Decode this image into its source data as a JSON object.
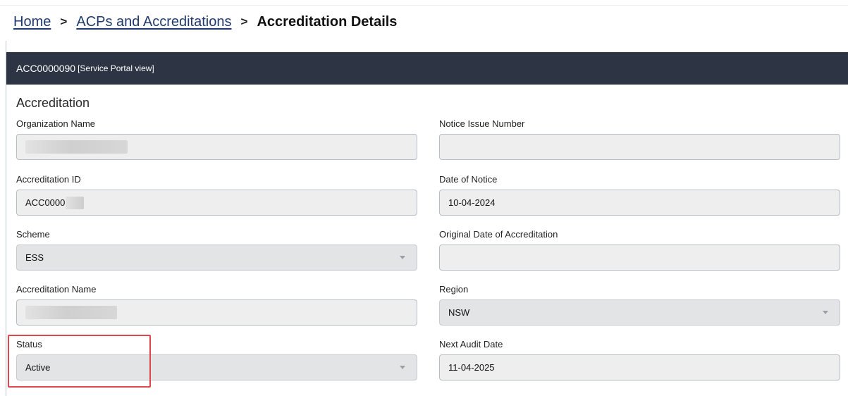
{
  "breadcrumb": {
    "home": "Home",
    "acps": "ACPs and Accreditations",
    "current": "Accreditation Details",
    "separator": ">"
  },
  "panel": {
    "record_id": "ACC0000090",
    "view_tag": "[Service Portal view]"
  },
  "section_title": "Accreditation",
  "fields": {
    "organization_name": {
      "label": "Organization Name",
      "value": ""
    },
    "notice_issue_number": {
      "label": "Notice Issue Number",
      "value": ""
    },
    "accreditation_id": {
      "label": "Accreditation ID",
      "value": "ACC0000"
    },
    "date_of_notice": {
      "label": "Date of Notice",
      "value": "10-04-2024"
    },
    "scheme": {
      "label": "Scheme",
      "value": "ESS"
    },
    "original_date": {
      "label": "Original Date of Accreditation",
      "value": ""
    },
    "accreditation_name": {
      "label": "Accreditation Name",
      "value": ""
    },
    "region": {
      "label": "Region",
      "value": "NSW"
    },
    "status": {
      "label": "Status",
      "value": "Active"
    },
    "next_audit_date": {
      "label": "Next Audit Date",
      "value": "11-04-2025"
    }
  },
  "colors": {
    "header_bg": "#2d3443",
    "link": "#1f3a6e",
    "highlight": "#e0474c"
  },
  "icons": {
    "breadcrumb_separator": "chevron-right-icon",
    "select_arrow": "chevron-down-icon"
  }
}
